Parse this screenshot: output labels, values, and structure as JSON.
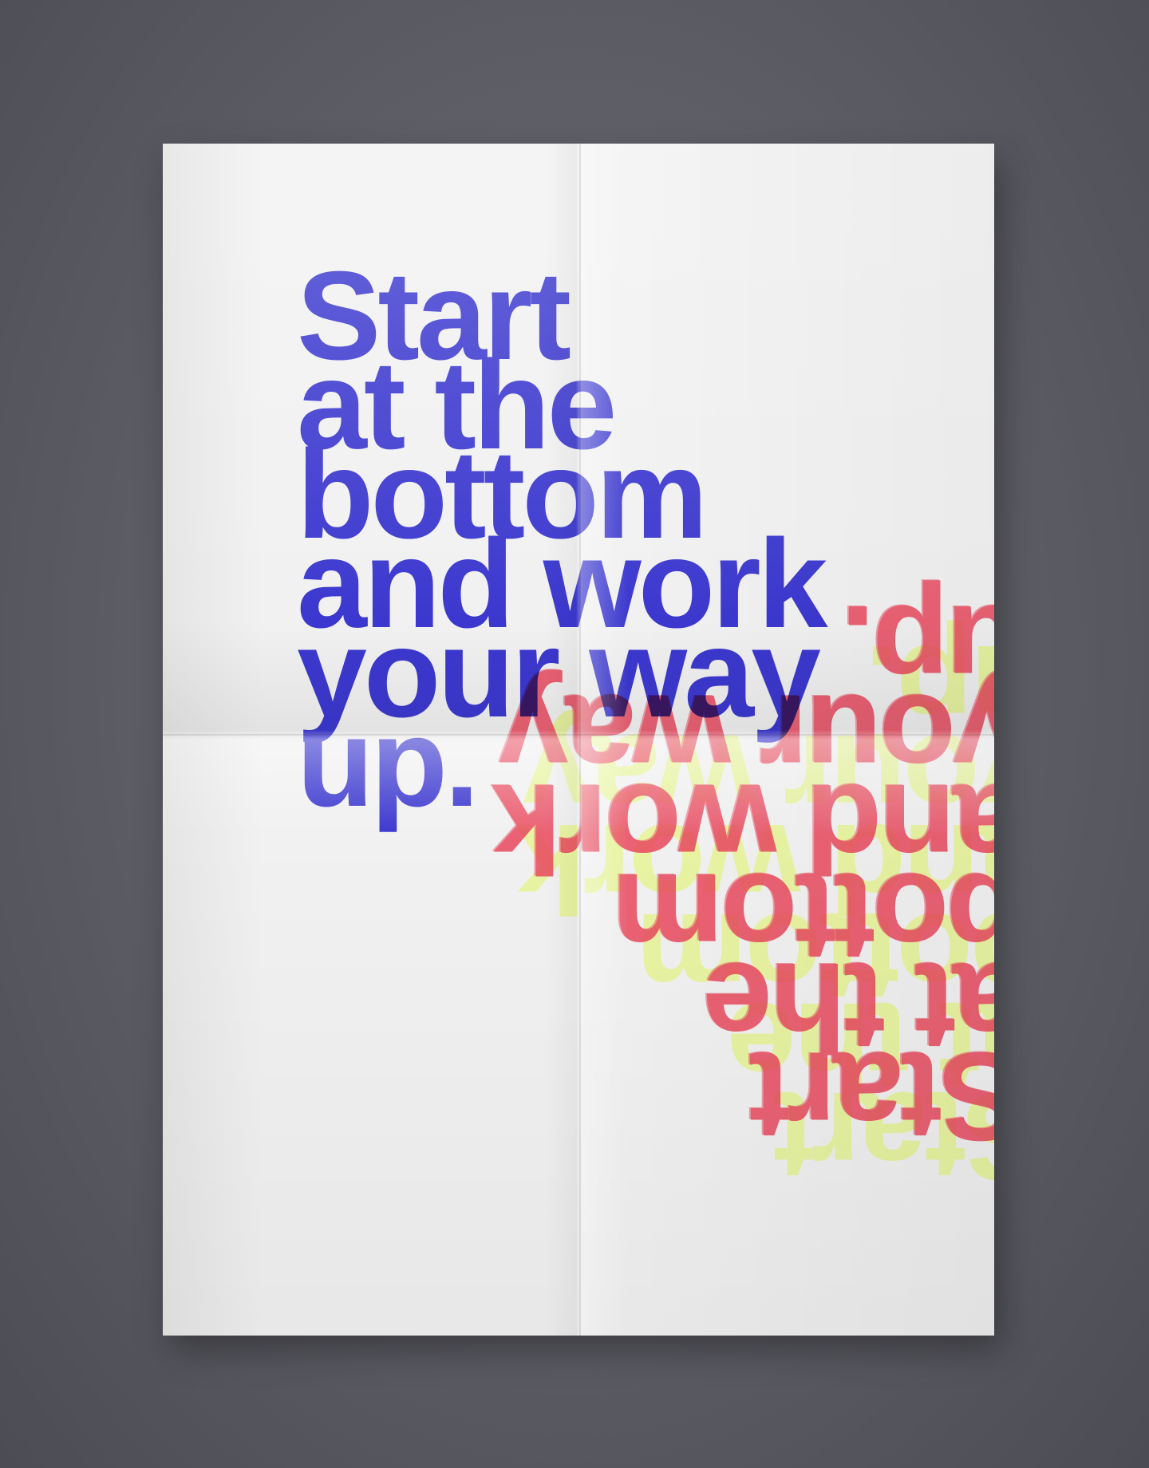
{
  "poster": {
    "lines": [
      "Start",
      "at the",
      "bottom",
      "and work",
      "your way",
      "up."
    ]
  },
  "colors": {
    "background": "#5c5c64",
    "paper": "#f1f1f1",
    "primary_text": "#3f3bdb",
    "echo_red": "#e9485e",
    "echo_yellow": "#e8f59a"
  }
}
